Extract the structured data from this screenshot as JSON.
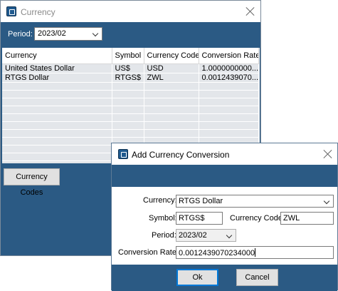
{
  "currency_window": {
    "title": "Currency",
    "period_label": "Period:",
    "period_value": "2023/02",
    "columns": [
      "Currency",
      "Symbol",
      "Currency Code",
      "Conversion Rate"
    ],
    "rows": [
      [
        "United States Dollar",
        "US$",
        "USD",
        "1.0000000000..."
      ],
      [
        "RTGS Dollar",
        "RTGS$",
        "ZWL",
        "0.0012439070..."
      ]
    ],
    "codes_button": "Currency Codes"
  },
  "dialog": {
    "title": "Add Currency Conversion",
    "currency_label": "Currency:",
    "currency_value": "RTGS Dollar",
    "symbol_label": "Symbol:",
    "symbol_value": "RTGS$",
    "code_label": "Currency Code:",
    "code_value": "ZWL",
    "period_label": "Period:",
    "period_value": "2023/02",
    "rate_label": "Conversion Rate:",
    "rate_value": "0.0012439070234000",
    "ok_label": "Ok",
    "cancel_label": "Cancel"
  },
  "icons": {
    "app": "app-window-icon",
    "close": "close-icon",
    "dropdown": "chevron-down-icon"
  },
  "colors": {
    "band": "#2b5a84",
    "grid": "#e3e6ea",
    "focus": "#0078d7"
  }
}
